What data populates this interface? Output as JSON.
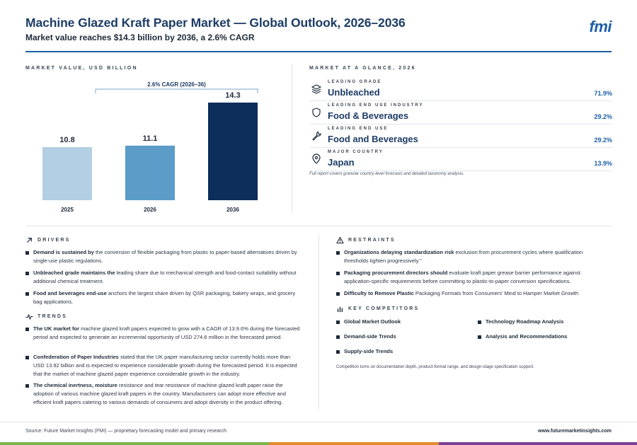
{
  "header": {
    "title": "Machine Glazed Kraft Paper Market — Global Outlook, 2026–2036",
    "subtitle": "Market value reaches $14.3 billion by 2036, a 2.6% CAGR",
    "logo": "fmi"
  },
  "market_value": {
    "label": "MARKET VALUE, USD BILLION"
  },
  "chart_data": {
    "type": "bar",
    "categories": [
      "2025",
      "2026",
      "2036"
    ],
    "values": [
      10.8,
      11.1,
      14.3
    ],
    "value_labels": [
      "10.8",
      "11.1",
      "14.3"
    ],
    "colors": [
      "#b2cfe3",
      "#5b9cc9",
      "#0d2d5a"
    ],
    "annotation": "2.6% CAGR (2026–36)",
    "ylim": [
      0,
      15
    ],
    "grid": false
  },
  "glance": {
    "label": "MARKET AT A GLANCE, 2026",
    "rows": [
      {
        "category": "LEADING GRADE",
        "value": "Unbleached",
        "pct": "71.9%",
        "icon": "layers-icon"
      },
      {
        "category": "LEADING END USE INDUSTRY",
        "value": "Food & Beverages",
        "pct": "29.2%",
        "icon": "shield-icon"
      },
      {
        "category": "LEADING END USE",
        "value": "Food and Beverages",
        "pct": "29.2%",
        "icon": "wrench-icon"
      },
      {
        "category": "MAJOR COUNTRY",
        "value": "Japan",
        "pct": "13.9%",
        "icon": "map-pin-icon"
      }
    ],
    "note": "Full report covers granular country-level forecasts and detailed taxonomy analysis."
  },
  "drivers": {
    "label": "DRIVERS",
    "items": [
      {
        "bold": "Demand is sustained by",
        "text": " the conversion of flexible packaging from plastic to paper-based alternatives driven by single-use plastic regulations."
      },
      {
        "bold": "Unbleached grade maintains the",
        "text": " leading share due to mechanical strength and food-contact suitability without additional chemical treatment."
      },
      {
        "bold": "Food and beverages end-use",
        "text": " anchors the largest share driven by QSR packaging, bakery wraps, and grocery bag applications."
      }
    ]
  },
  "trends": {
    "label": "TRENDS",
    "items": [
      {
        "bold": "The UK market for",
        "text": " machine glazed kraft papers expected to grow with a CAGR of 13.9.6% during the forecasted period and expected to generate an incremental opportunity of USD 274.6 million in the forecasted period."
      },
      {
        "bold": "Confederation of Paper Industries",
        "text": " stated that the UK paper manufacturing sector currently holds more than USD 13.92 billion and is expected to experience considerable growth during the forecasted period. It is expected that the market of machine glazed paper experience considerable growth in the industry."
      },
      {
        "bold": "The chemical inertness, moisture",
        "text": " resistance and tear resistance of machine glazed kraft paper raise the adoption of various machine glazed kraft papers in the country. Manufacturers can adopt more effective and efficient kraft papers catering to various demands of consumers and adopt diversity in the product offering."
      }
    ]
  },
  "restraints": {
    "label": "RESTRAINTS",
    "items": [
      {
        "bold": "Organizations delaying standardization risk",
        "text": " exclusion from procurement cycles where qualification thresholds tighten progressively.\""
      },
      {
        "bold": "Packaging procurement directors should",
        "text": " evaluate kraft paper grease barrier performance against application-specific requirements before committing to plastic-to-paper conversion specifications."
      },
      {
        "bold": "Difficulty to Remove Plastic",
        "text": " Packaging Formats from Consumers' Mind to Hamper Market Growth"
      }
    ]
  },
  "competitors": {
    "label": "KEY COMPETITORS",
    "items": [
      "Global Market Outlook",
      "Technology Roadmap Analysis",
      "Demand-side Trends",
      "Analysis and Recommendations",
      "Supply-side Trends"
    ],
    "note": "Competition turns on documentation depth, product-format range, and design-stage specification support."
  },
  "footer": {
    "source": "Source: Future Market Insights (FMI) — proprietary forecasting model and primary research",
    "url": "www.futuremarketinsights.com",
    "stripe_colors": [
      "#7ab648",
      "#e8892b",
      "#7b3f98"
    ]
  }
}
